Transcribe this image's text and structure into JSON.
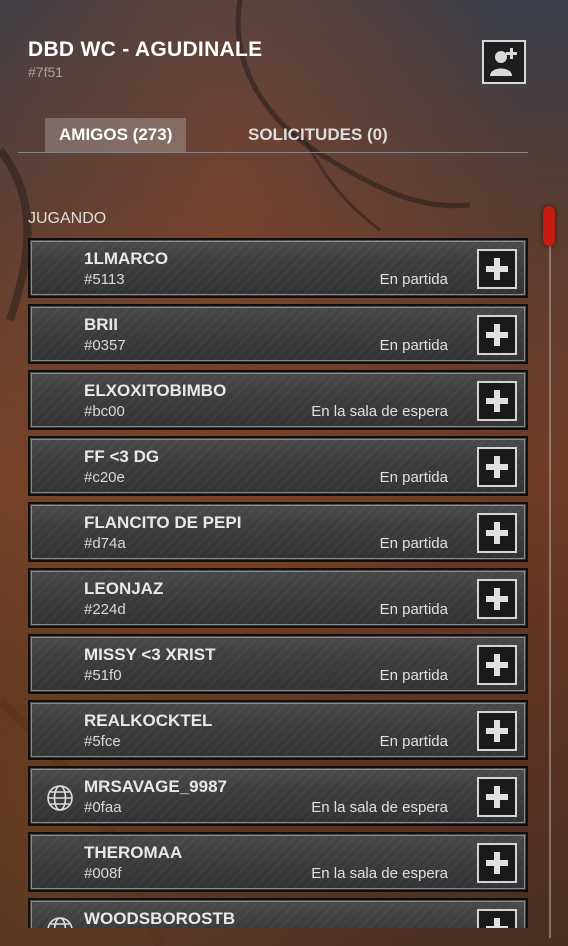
{
  "header": {
    "title": "DBD WC - AGUDINALE",
    "tag": "#7f51"
  },
  "tabs": [
    {
      "label": "AMIGOS (273)",
      "active": true
    },
    {
      "label": "SOLICITUDES (0)",
      "active": false
    }
  ],
  "section": {
    "label": "JUGANDO"
  },
  "icons": {
    "add_friend": "add-user-icon",
    "invite": "plus-icon",
    "crossplay": "globe-icon"
  },
  "colors": {
    "scrollbar": "#c51b12"
  },
  "friends": [
    {
      "name": "1LMARCO",
      "id": "#5113",
      "status": "En partida",
      "crossplay": false
    },
    {
      "name": "BRII",
      "id": "#0357",
      "status": "En partida",
      "crossplay": false
    },
    {
      "name": "ELXOXITOBIMBO",
      "id": "#bc00",
      "status": "En la sala de espera",
      "crossplay": false
    },
    {
      "name": "FF <3 DG",
      "id": "#c20e",
      "status": "En partida",
      "crossplay": false
    },
    {
      "name": "FLANCITO DE PEPI",
      "id": "#d74a",
      "status": "En partida",
      "crossplay": false
    },
    {
      "name": "LEONJAZ",
      "id": "#224d",
      "status": "En partida",
      "crossplay": false
    },
    {
      "name": "MISSY <3 XRIST",
      "id": "#51f0",
      "status": "En partida",
      "crossplay": false
    },
    {
      "name": "REALKOCKTEL",
      "id": "#5fce",
      "status": "En partida",
      "crossplay": false
    },
    {
      "name": "MRSAVAGE_9987",
      "id": "#0faa",
      "status": "En la sala de espera",
      "crossplay": true
    },
    {
      "name": "THEROMAA",
      "id": "#008f",
      "status": "En la sala de espera",
      "crossplay": false
    },
    {
      "name": "WOODSBOROSTB",
      "id": "",
      "status": "",
      "crossplay": true
    }
  ]
}
